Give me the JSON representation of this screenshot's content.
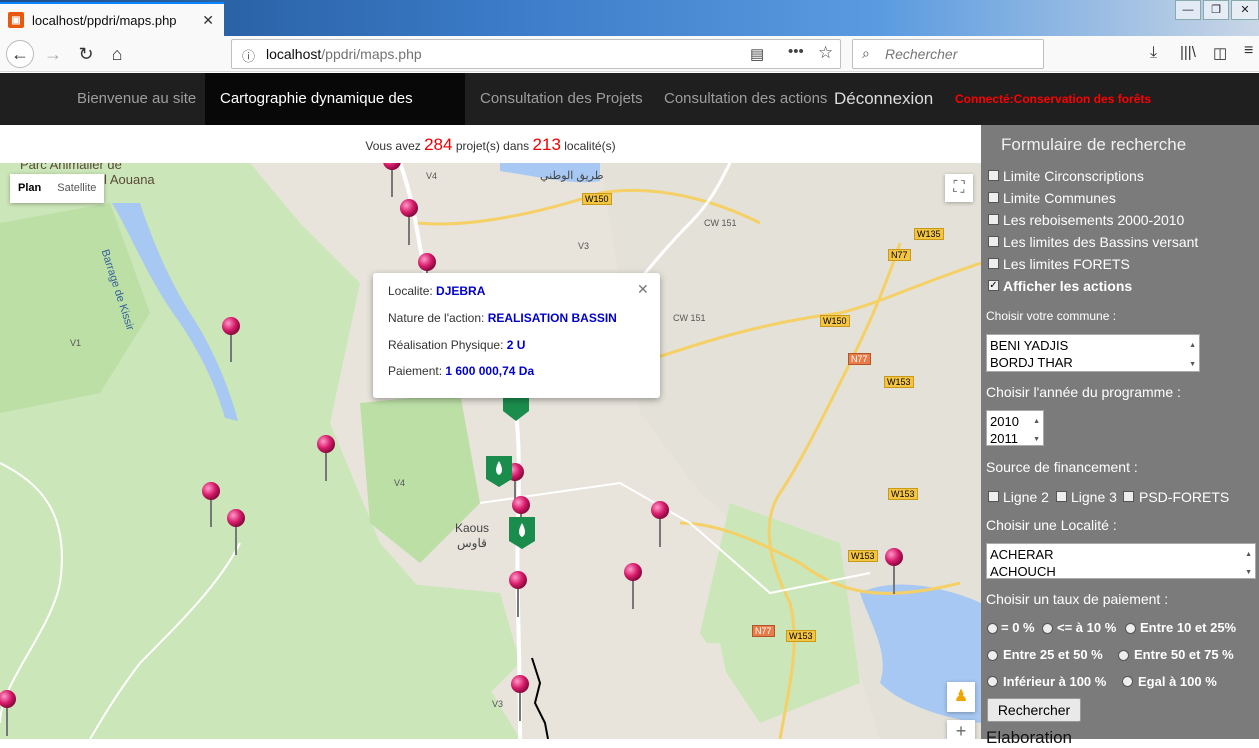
{
  "browser": {
    "tab_title": "localhost/ppdri/maps.php",
    "url_host": "localhost",
    "url_path": "/ppdri/maps.php",
    "search_placeholder": "Rechercher"
  },
  "site_nav": {
    "items": [
      {
        "label": "Bienvenue au site"
      },
      {
        "label": "Cartographie dynamique des projets"
      },
      {
        "label": "Consultation des Projets"
      },
      {
        "label": "Consultation des actions"
      }
    ],
    "logout": "Déconnexion",
    "connected": "Connecté:Conservation des forêts"
  },
  "counter": {
    "prefix": "Vous avez",
    "projects": "284",
    "middle": "projet(s) dans",
    "localities": "213",
    "suffix": "localité(s)"
  },
  "map": {
    "type_buttons": [
      "Plan",
      "Satellite"
    ],
    "labels": {
      "park": "Parc Animalier de",
      "park2": "Kissir El Aouana",
      "barrage": "Barrage de Kissir",
      "kaous": "Kaous",
      "kaous_ar": "قاوس",
      "road_ar": "طريق الوطني"
    },
    "road_badges": [
      "W150",
      "W135",
      "N77",
      "W150",
      "W153",
      "N77",
      "W153",
      "W153",
      "N77",
      "W153"
    ],
    "road_refs": [
      "V4",
      "V3",
      "CW 151",
      "CW 151",
      "V4",
      "V1",
      "V3"
    ]
  },
  "popup": {
    "localite_label": "Localite:",
    "localite": "DJEBRA",
    "nature_label": "Nature de l'action:",
    "nature": "REALISATION BASSIN",
    "realisation_label": "Réalisation Physique:",
    "realisation": "2 U",
    "paiement_label": "Paiement:",
    "paiement": "1 600 000,74 Da"
  },
  "panel": {
    "title": "Formulaire de recherche",
    "layers": [
      {
        "label": "Limite Circonscriptions",
        "checked": false
      },
      {
        "label": "Limite Communes",
        "checked": false
      },
      {
        "label": "Les reboisements 2000-2010",
        "checked": false
      },
      {
        "label": "Les limites des Bassins versant",
        "checked": false
      },
      {
        "label": "Les limites FORETS",
        "checked": false
      },
      {
        "label": "Afficher les actions",
        "checked": true
      }
    ],
    "commune_label": "Choisir votre commune :",
    "communes": [
      "BENI YADJIS",
      "BORDJ THAR"
    ],
    "annee_label": "Choisir l'année du programme :",
    "annees": [
      "2010",
      "2011"
    ],
    "source_label": "Source de financement :",
    "sources": [
      "Ligne 2",
      "Ligne 3",
      "PSD-FORETS"
    ],
    "localite_label": "Choisir une Localité :",
    "localites": [
      "ACHERAR",
      "ACHOUCH"
    ],
    "taux_label": "Choisir un taux de paiement :",
    "taux": [
      "= 0 %",
      "<= à 10 %",
      "Entre 10 et 25%",
      "Entre 25 et 50 %",
      "Entre 50 et 75 %",
      "Inférieur à 100 %",
      "Egal à 100 %"
    ],
    "search_button": "Rechercher",
    "cut_heading": "Elaboration"
  }
}
